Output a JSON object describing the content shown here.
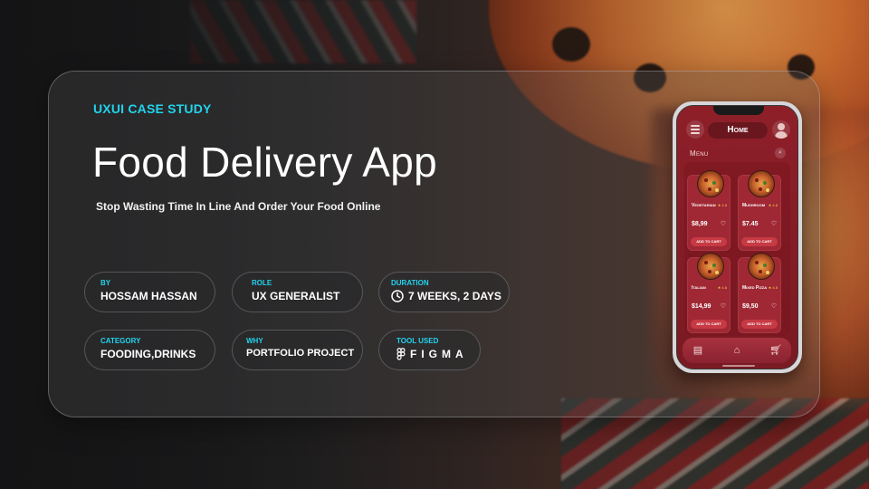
{
  "hero": {
    "eyebrow": "UXUI CASE STUDY",
    "title": "Food Delivery App",
    "subtitle": "Stop Wasting Time In Line And Order Your Food Online"
  },
  "info": [
    {
      "label": "BY",
      "value": "HOSSAM HASSAN",
      "icon": ""
    },
    {
      "label": "ROLE",
      "value": "UX GENERALIST",
      "icon": ""
    },
    {
      "label": "DURATION",
      "value": "7 WEEKS, 2 DAYS",
      "icon": "clock-icon"
    },
    {
      "label": "CATEGORY",
      "value": "FOODING,DRINKS",
      "icon": ""
    },
    {
      "label": "WHY",
      "value": "PORTFOLIO PROJECT",
      "icon": ""
    },
    {
      "label": "TOOL USED",
      "value": "FIGMA",
      "icon": "figma-icon"
    }
  ],
  "phone": {
    "header_title": "Home",
    "menu_label": "Menu",
    "items": [
      {
        "name": "Vegetarian",
        "rating": "★ 4.8",
        "price": "$8,99",
        "button": "Add to cart"
      },
      {
        "name": "Mushroom",
        "rating": "★ 4.8",
        "price": "$7.45",
        "button": "Add to cart"
      },
      {
        "name": "Italian",
        "rating": "★ 4.8",
        "price": "$14,99",
        "button": "Add to cart"
      },
      {
        "name": "Mixed Pizza",
        "rating": "★ 4.8",
        "price": "$9,50",
        "button": "Add to cart"
      }
    ],
    "nav_icons": [
      "menu-list-icon",
      "home-icon",
      "cart-icon"
    ]
  },
  "colors": {
    "accent": "#22d3ee",
    "phone_primary": "#8e1f29",
    "phone_button": "#c73a44"
  }
}
